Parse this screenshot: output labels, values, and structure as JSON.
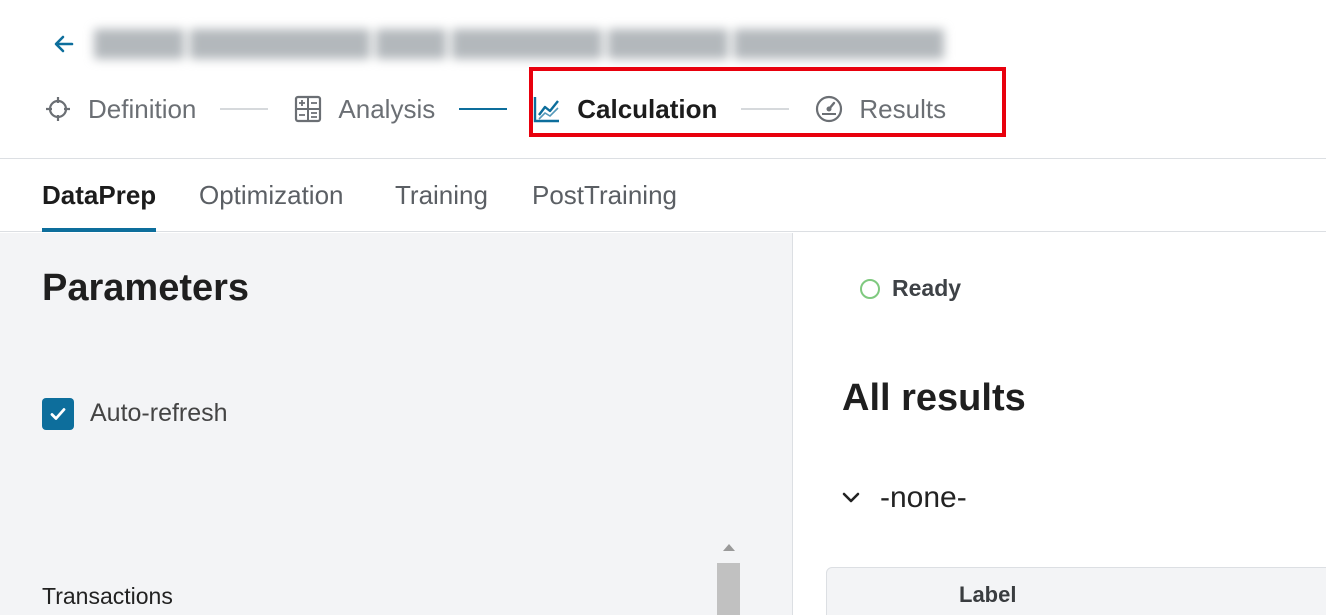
{
  "header": {
    "back_icon": "arrow-left-icon",
    "title_redacted": true
  },
  "steps": [
    {
      "label": "Definition",
      "icon": "crosshair-icon",
      "state": "default"
    },
    {
      "label": "Analysis",
      "icon": "calculator-icon",
      "state": "default"
    },
    {
      "label": "Calculation",
      "icon": "line-chart-icon",
      "state": "active"
    },
    {
      "label": "Results",
      "icon": "gauge-icon",
      "state": "default"
    }
  ],
  "tabs": [
    {
      "label": "DataPrep",
      "active": true
    },
    {
      "label": "Optimization",
      "active": false
    },
    {
      "label": "Training",
      "active": false
    },
    {
      "label": "PostTraining",
      "active": false
    }
  ],
  "parameters": {
    "title": "Parameters",
    "auto_refresh_label": "Auto-refresh",
    "auto_refresh_checked": true,
    "transactions_label": "Transactions"
  },
  "results": {
    "status_label": "Ready",
    "title": "All results",
    "group_label": "-none-",
    "table_columns": [
      "Label"
    ]
  },
  "colors": {
    "accent": "#0d6e9c",
    "highlight": "#e8000d",
    "ready": "#7fc97f"
  }
}
